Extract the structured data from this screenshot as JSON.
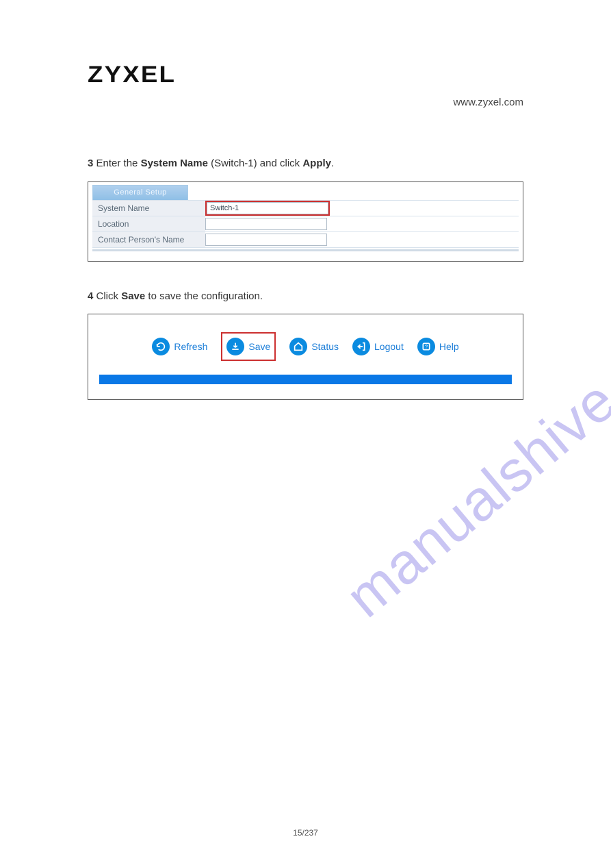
{
  "header": {
    "brand": "ZYXEL",
    "handbook": "www.zyxel.com",
    "handbook_url": "www.zyxel.com"
  },
  "steps": {
    "step3": {
      "num": "3",
      "lead": "Enter the ",
      "bold": "System Name",
      "tail": " (Switch-1) and click "
    },
    "step4": {
      "num": "4",
      "lead": "Click ",
      "bold": "Save",
      "tail": " to save the configuration."
    }
  },
  "setup": {
    "tab_label": "General Setup",
    "rows": [
      {
        "label": "System Name",
        "value": "Switch-1",
        "highlight": true
      },
      {
        "label": "Location",
        "value": "",
        "highlight": false
      },
      {
        "label": "Contact Person's Name",
        "value": "",
        "highlight": false
      }
    ]
  },
  "apply_label": "Apply",
  "toolbar": {
    "items": [
      {
        "label": "Refresh",
        "icon": "refresh",
        "highlight": false
      },
      {
        "label": "Save",
        "icon": "save",
        "highlight": true
      },
      {
        "label": "Status",
        "icon": "status",
        "highlight": false
      },
      {
        "label": "Logout",
        "icon": "logout",
        "highlight": false
      },
      {
        "label": "Help",
        "icon": "help",
        "highlight": false
      }
    ]
  },
  "watermark": "manualshive.com",
  "footer": "15/237"
}
